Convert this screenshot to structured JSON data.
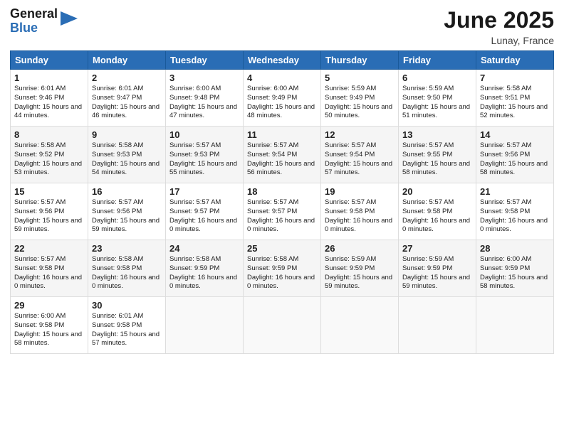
{
  "logo": {
    "general": "General",
    "blue": "Blue"
  },
  "title": "June 2025",
  "location": "Lunay, France",
  "days_header": [
    "Sunday",
    "Monday",
    "Tuesday",
    "Wednesday",
    "Thursday",
    "Friday",
    "Saturday"
  ],
  "weeks": [
    [
      {
        "day": "1",
        "sunrise": "6:01 AM",
        "sunset": "9:46 PM",
        "daylight": "15 hours and 44 minutes."
      },
      {
        "day": "2",
        "sunrise": "6:01 AM",
        "sunset": "9:47 PM",
        "daylight": "15 hours and 46 minutes."
      },
      {
        "day": "3",
        "sunrise": "6:00 AM",
        "sunset": "9:48 PM",
        "daylight": "15 hours and 47 minutes."
      },
      {
        "day": "4",
        "sunrise": "6:00 AM",
        "sunset": "9:49 PM",
        "daylight": "15 hours and 48 minutes."
      },
      {
        "day": "5",
        "sunrise": "5:59 AM",
        "sunset": "9:49 PM",
        "daylight": "15 hours and 50 minutes."
      },
      {
        "day": "6",
        "sunrise": "5:59 AM",
        "sunset": "9:50 PM",
        "daylight": "15 hours and 51 minutes."
      },
      {
        "day": "7",
        "sunrise": "5:58 AM",
        "sunset": "9:51 PM",
        "daylight": "15 hours and 52 minutes."
      }
    ],
    [
      {
        "day": "8",
        "sunrise": "5:58 AM",
        "sunset": "9:52 PM",
        "daylight": "15 hours and 53 minutes."
      },
      {
        "day": "9",
        "sunrise": "5:58 AM",
        "sunset": "9:53 PM",
        "daylight": "15 hours and 54 minutes."
      },
      {
        "day": "10",
        "sunrise": "5:57 AM",
        "sunset": "9:53 PM",
        "daylight": "15 hours and 55 minutes."
      },
      {
        "day": "11",
        "sunrise": "5:57 AM",
        "sunset": "9:54 PM",
        "daylight": "15 hours and 56 minutes."
      },
      {
        "day": "12",
        "sunrise": "5:57 AM",
        "sunset": "9:54 PM",
        "daylight": "15 hours and 57 minutes."
      },
      {
        "day": "13",
        "sunrise": "5:57 AM",
        "sunset": "9:55 PM",
        "daylight": "15 hours and 58 minutes."
      },
      {
        "day": "14",
        "sunrise": "5:57 AM",
        "sunset": "9:56 PM",
        "daylight": "15 hours and 58 minutes."
      }
    ],
    [
      {
        "day": "15",
        "sunrise": "5:57 AM",
        "sunset": "9:56 PM",
        "daylight": "15 hours and 59 minutes."
      },
      {
        "day": "16",
        "sunrise": "5:57 AM",
        "sunset": "9:56 PM",
        "daylight": "15 hours and 59 minutes."
      },
      {
        "day": "17",
        "sunrise": "5:57 AM",
        "sunset": "9:57 PM",
        "daylight": "16 hours and 0 minutes."
      },
      {
        "day": "18",
        "sunrise": "5:57 AM",
        "sunset": "9:57 PM",
        "daylight": "16 hours and 0 minutes."
      },
      {
        "day": "19",
        "sunrise": "5:57 AM",
        "sunset": "9:58 PM",
        "daylight": "16 hours and 0 minutes."
      },
      {
        "day": "20",
        "sunrise": "5:57 AM",
        "sunset": "9:58 PM",
        "daylight": "16 hours and 0 minutes."
      },
      {
        "day": "21",
        "sunrise": "5:57 AM",
        "sunset": "9:58 PM",
        "daylight": "16 hours and 0 minutes."
      }
    ],
    [
      {
        "day": "22",
        "sunrise": "5:57 AM",
        "sunset": "9:58 PM",
        "daylight": "16 hours and 0 minutes."
      },
      {
        "day": "23",
        "sunrise": "5:58 AM",
        "sunset": "9:58 PM",
        "daylight": "16 hours and 0 minutes."
      },
      {
        "day": "24",
        "sunrise": "5:58 AM",
        "sunset": "9:59 PM",
        "daylight": "16 hours and 0 minutes."
      },
      {
        "day": "25",
        "sunrise": "5:58 AM",
        "sunset": "9:59 PM",
        "daylight": "16 hours and 0 minutes."
      },
      {
        "day": "26",
        "sunrise": "5:59 AM",
        "sunset": "9:59 PM",
        "daylight": "15 hours and 59 minutes."
      },
      {
        "day": "27",
        "sunrise": "5:59 AM",
        "sunset": "9:59 PM",
        "daylight": "15 hours and 59 minutes."
      },
      {
        "day": "28",
        "sunrise": "6:00 AM",
        "sunset": "9:59 PM",
        "daylight": "15 hours and 58 minutes."
      }
    ],
    [
      {
        "day": "29",
        "sunrise": "6:00 AM",
        "sunset": "9:58 PM",
        "daylight": "15 hours and 58 minutes."
      },
      {
        "day": "30",
        "sunrise": "6:01 AM",
        "sunset": "9:58 PM",
        "daylight": "15 hours and 57 minutes."
      },
      null,
      null,
      null,
      null,
      null
    ]
  ]
}
